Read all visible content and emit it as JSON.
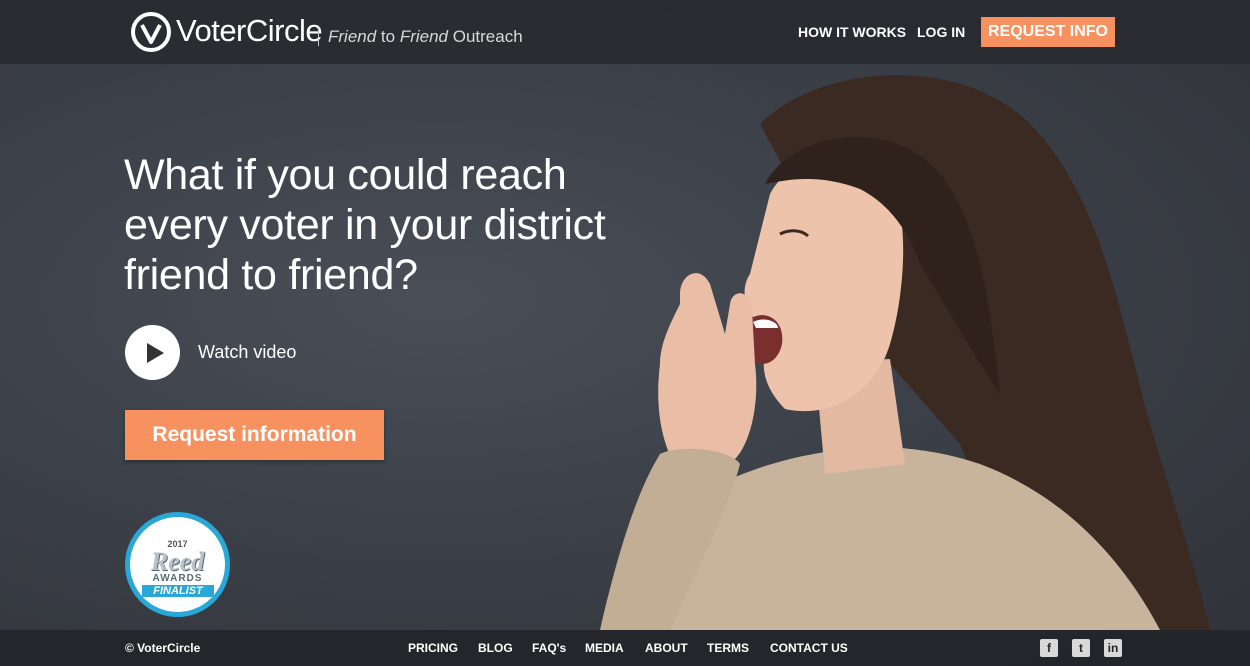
{
  "header": {
    "brand": "VoterCircle",
    "tagline_friend1": "Friend",
    "tagline_to": " to ",
    "tagline_friend2": "Friend",
    "tagline_outreach": " Outreach",
    "nav": {
      "how_it_works": "HOW IT WORKS",
      "log_in": "LOG IN",
      "request_info": "REQUEST INFO"
    }
  },
  "hero": {
    "headline_lines": [
      "What if you could reach",
      "every voter in your district",
      "friend to friend?"
    ],
    "watch_video": "Watch video",
    "request_button": "Request information"
  },
  "badge": {
    "year": "2017",
    "name": "Reed",
    "awards": "AWARDS",
    "finalist": "FINALIST"
  },
  "footer": {
    "copyright": "© VoterCircle",
    "links": [
      "PRICING",
      "BLOG",
      "FAQ's",
      "MEDIA",
      "ABOUT",
      "TERMS",
      "CONTACT US"
    ],
    "social": [
      {
        "icon": "facebook-icon",
        "glyph": "f"
      },
      {
        "icon": "twitter-icon",
        "glyph": "t"
      },
      {
        "icon": "linkedin-icon",
        "glyph": "in"
      }
    ]
  },
  "colors": {
    "accent": "#f7915f",
    "badge_blue": "#29a7d6",
    "bar_bg": "#282a30"
  }
}
